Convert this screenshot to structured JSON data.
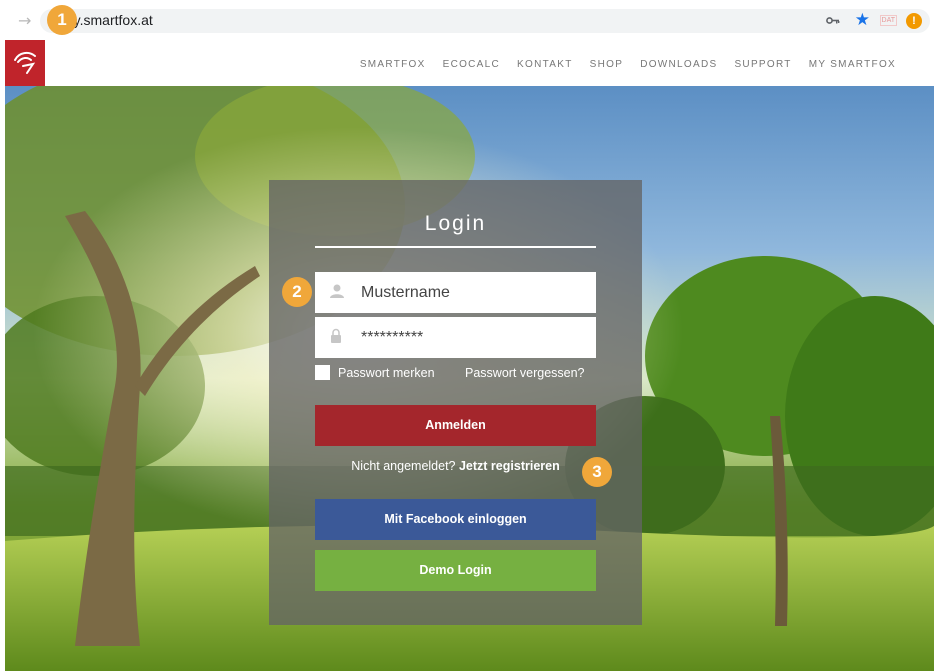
{
  "browser": {
    "url": "my.smartfox.at"
  },
  "site": {
    "nav": [
      "SMARTFOX",
      "ECOCALC",
      "KONTAKT",
      "SHOP",
      "DOWNLOADS",
      "SUPPORT",
      "MY SMARTFOX"
    ]
  },
  "login": {
    "title": "Login",
    "username_value": "Mustername",
    "password_value": "**********",
    "remember_label": "Passwort merken",
    "forgot_label": "Passwort vergessen?",
    "login_button": "Anmelden",
    "register_prefix": "Nicht angemeldet?",
    "register_link": "Jetzt registrieren",
    "facebook_button": "Mit Facebook einloggen",
    "demo_button": "Demo Login"
  },
  "badges": [
    "1",
    "2",
    "3"
  ],
  "colors": {
    "brand_red": "#c0242b",
    "login_red": "#a4262c",
    "facebook_blue": "#3b5998",
    "demo_green": "#76b041",
    "badge_orange": "#f0a73a"
  }
}
